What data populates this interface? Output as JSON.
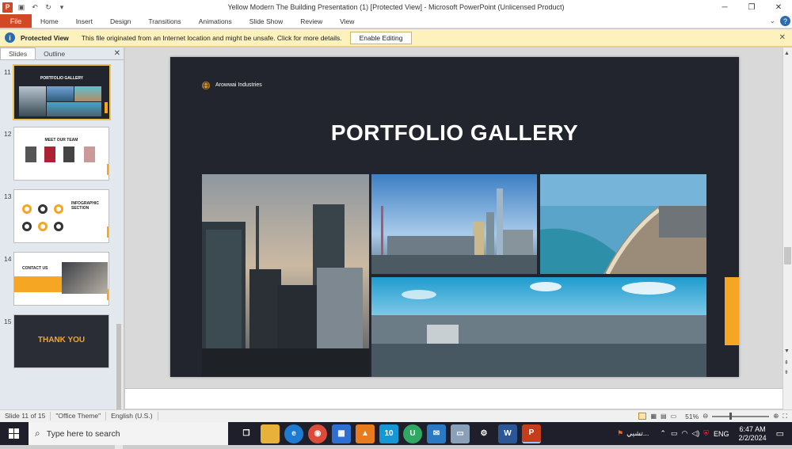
{
  "window": {
    "title": "Yellow Modern The Building Presentation (1) [Protected View]  -  Microsoft PowerPoint (Unlicensed Product)",
    "app_icon": "P",
    "minimize": "─",
    "restore": "❐",
    "close": "✕"
  },
  "ribbon": {
    "file": "File",
    "tabs": [
      "Home",
      "Insert",
      "Design",
      "Transitions",
      "Animations",
      "Slide Show",
      "Review",
      "View"
    ]
  },
  "message_bar": {
    "label": "Protected View",
    "message": "This file originated from an Internet location and might be unsafe. Click for more details.",
    "button": "Enable Editing"
  },
  "panel": {
    "tabs": [
      "Slides",
      "Outline"
    ]
  },
  "thumbs": [
    {
      "num": "11",
      "title": "PORTFOLIO GALLERY"
    },
    {
      "num": "12",
      "title": "MEET OUR TEAM"
    },
    {
      "num": "13",
      "title": "INFOGRAPHIC SECTION"
    },
    {
      "num": "14",
      "title": "CONTACT US"
    },
    {
      "num": "15",
      "title": "THANK YOU"
    }
  ],
  "slide": {
    "company": "Arowwai Industries",
    "title": "PORTFOLIO GALLERY",
    "accent": "#f5a623",
    "background": "#22252d"
  },
  "status": {
    "slide": "Slide 11 of 15",
    "theme": "\"Office Theme\"",
    "lang": "English (U.S.)",
    "zoom": "51%"
  },
  "taskbar": {
    "search": "Type here to search",
    "tray_text": "تشيي...",
    "lang": "ENG",
    "time": "6:47 AM",
    "date": "2/2/2024"
  }
}
